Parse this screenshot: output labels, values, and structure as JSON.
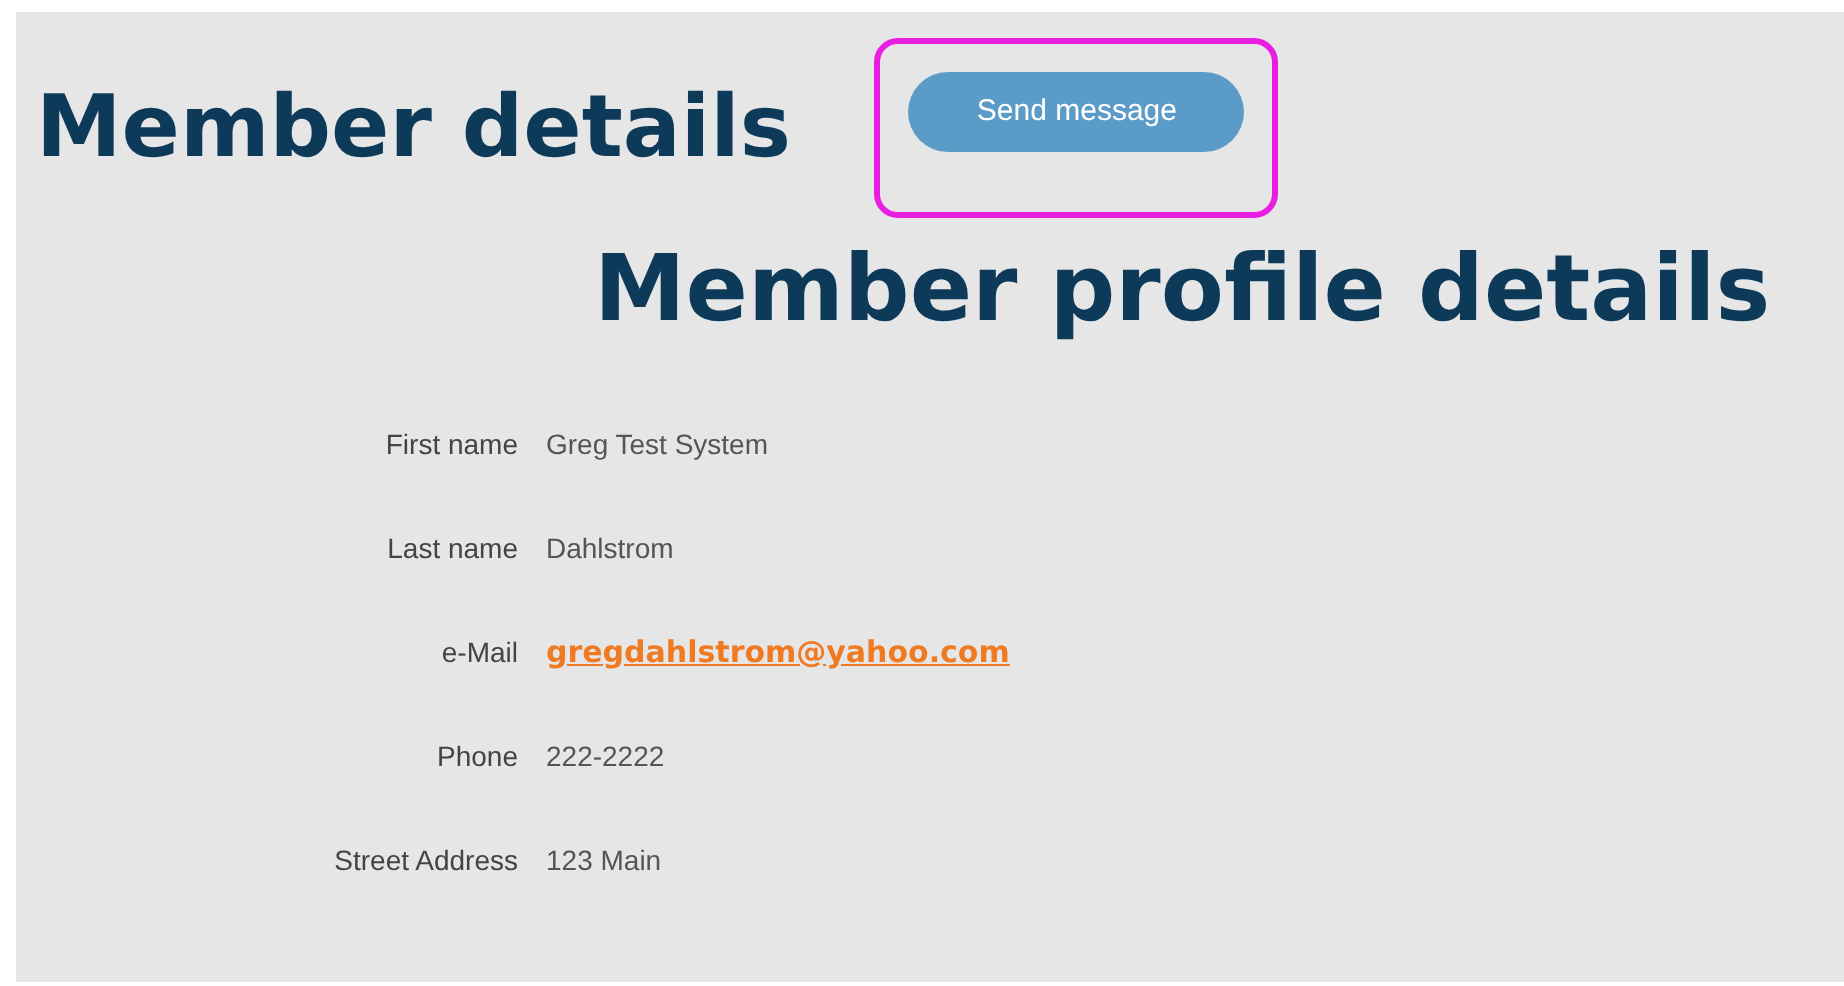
{
  "page": {
    "title": "Member details"
  },
  "send_button": {
    "label": "Send message",
    "highlighted": true
  },
  "profile": {
    "heading": "Member profile details",
    "fields": [
      {
        "label": "First name",
        "value": "Greg Test System",
        "kind": "text"
      },
      {
        "label": "Last name",
        "value": "Dahlstrom",
        "kind": "text"
      },
      {
        "label": "e-Mail",
        "value": "gregdahlstrom@yahoo.com",
        "kind": "link"
      },
      {
        "label": "Phone",
        "value": "222-2222",
        "kind": "text"
      },
      {
        "label": "Street Address",
        "value": "123 Main",
        "kind": "text"
      }
    ]
  }
}
